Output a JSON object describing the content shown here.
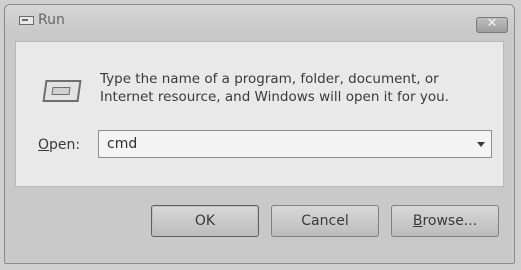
{
  "window": {
    "title": "Run",
    "close_label": "✕"
  },
  "dialog": {
    "description": "Type the name of a program, folder, document, or Internet resource, and Windows will open it for you.",
    "open_label_accel": "O",
    "open_label_rest": "pen:",
    "command_value": "cmd"
  },
  "buttons": {
    "ok": "OK",
    "cancel": "Cancel",
    "browse_accel": "B",
    "browse_rest": "rowse..."
  },
  "icons": {
    "title": "run-app-icon",
    "dialog": "run-dialog-icon",
    "dropdown": "chevron-down-icon"
  }
}
